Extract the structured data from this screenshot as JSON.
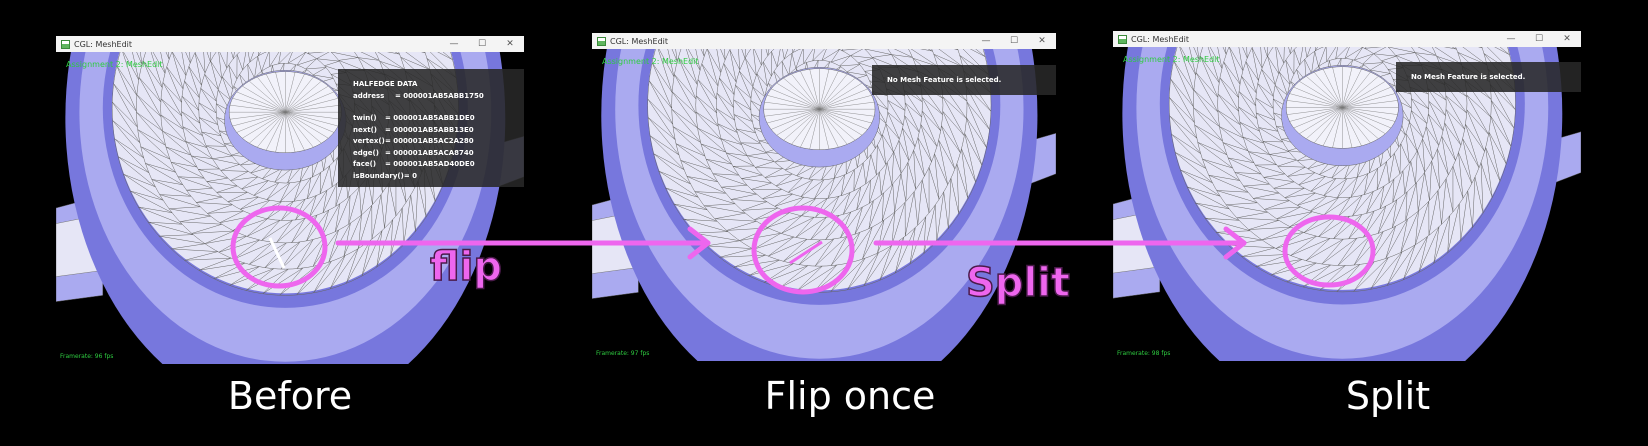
{
  "windows": [
    {
      "title": "CGL: MeshEdit",
      "hud_title": "Assignment 2: MeshEdit",
      "framerate": "Framerate: 96 fps",
      "halfedge": {
        "header": "HALFEDGE DATA",
        "rows": [
          {
            "key": "address",
            "value": "= 000001AB5ABB1750"
          },
          {
            "key": "twin()",
            "value": "= 000001AB5ABB1DE0"
          },
          {
            "key": "next()",
            "value": "= 000001AB5ABB13E0"
          },
          {
            "key": "vertex()",
            "value": "= 000001AB5AC2A280"
          },
          {
            "key": "edge()",
            "value": "= 000001AB5ACA8740"
          },
          {
            "key": "face()",
            "value": "= 000001AB5AD40DE0"
          },
          {
            "key": "isBoundary()",
            "value": "= 0"
          }
        ]
      }
    },
    {
      "title": "CGL: MeshEdit",
      "hud_title": "Assignment 2: MeshEdit",
      "framerate": "Framerate: 97 fps",
      "status": "No Mesh Feature is selected."
    },
    {
      "title": "CGL: MeshEdit",
      "hud_title": "Assignment 2: MeshEdit",
      "framerate": "Framerate: 98 fps",
      "status": "No Mesh Feature is selected."
    }
  ],
  "window_controls": {
    "minimize": "—",
    "maximize": "☐",
    "close": "✕"
  },
  "annotations": {
    "flip_label": "flip",
    "split_label": "Split",
    "accent_color": "#ee66ee"
  },
  "captions": [
    "Before",
    "Flip once",
    "Split"
  ],
  "colors": {
    "mesh_light": "#e6e6f6",
    "mesh_mid": "#aaaaf0",
    "mesh_dark": "#7777dd",
    "hud_green": "#2ecc40"
  }
}
